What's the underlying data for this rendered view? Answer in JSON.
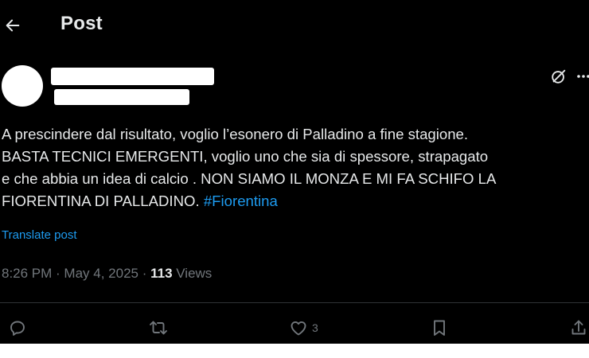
{
  "header": {
    "back_icon": "arrow-left-icon",
    "title": "Post"
  },
  "author": {
    "avatar": "redacted",
    "name": "",
    "handle": ""
  },
  "top_actions": {
    "grok_icon": "grok-slash-circle-icon",
    "more_icon": "more-horizontal-icon"
  },
  "tweet": {
    "line1": "A prescindere dal risultato, voglio l’esonero di Palladino a fine stagione.",
    "line2": "BASTA TECNICI EMERGENTI, voglio uno che sia di spessore, strapagato",
    "line3": "e che abbia un idea di calcio . NON SIAMO IL MONZA E MI FA SCHIFO LA",
    "line4": "FIORENTINA DI PALLADINO. ",
    "hashtag": "#Fiorentina",
    "translate_label": "Translate post"
  },
  "meta": {
    "time": "8:26 PM",
    "separator": " · ",
    "date": "May 4, 2025",
    "separator2": " · ",
    "views_count": "113",
    "views_label": " Views"
  },
  "actions": {
    "reply_icon": "reply-bubble-icon",
    "repost_icon": "repost-arrows-icon",
    "like_icon": "heart-icon",
    "like_count": "3",
    "bookmark_icon": "bookmark-icon",
    "share_icon": "share-upload-icon"
  },
  "colors": {
    "background": "#000000",
    "text": "#e7e9ea",
    "secondary": "#71767b",
    "link": "#1d9bf0",
    "divider": "#2f3336"
  }
}
